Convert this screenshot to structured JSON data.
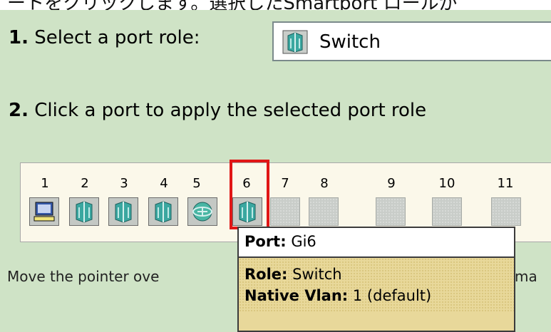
{
  "top_partial_text": "ートをクリックします。選択したSmartport ロールが",
  "step1": {
    "number": "1.",
    "text": "Select a port role:"
  },
  "role_select": {
    "value": "Switch",
    "icon": "switch-icon"
  },
  "step2": {
    "number": "2.",
    "text": "Click a port to apply the selected port role"
  },
  "ports": [
    {
      "label": "1",
      "icon": "desktop-icon"
    },
    {
      "label": "2",
      "icon": "switch-icon"
    },
    {
      "label": "3",
      "icon": "switch-icon"
    },
    {
      "label": "4",
      "icon": "switch-icon"
    },
    {
      "label": "5",
      "icon": "router-icon"
    },
    {
      "label": "6",
      "icon": "switch-icon"
    },
    {
      "label": "7",
      "icon": "empty"
    },
    {
      "label": "8",
      "icon": "empty"
    },
    {
      "label": "9",
      "icon": "empty"
    },
    {
      "label": "10",
      "icon": "empty"
    },
    {
      "label": "11",
      "icon": "empty"
    }
  ],
  "hint": {
    "text": "Move the pointer ove",
    "tail": "ma"
  },
  "tooltip": {
    "port_label": "Port:",
    "port_value": "Gi6",
    "role_label": "Role:",
    "role_value": "Switch",
    "vlan_label": "Native Vlan:",
    "vlan_value": "1 (default)"
  },
  "colors": {
    "background": "#cfe3c6",
    "highlight": "#e01616",
    "tooltip": "#e8d89a"
  }
}
